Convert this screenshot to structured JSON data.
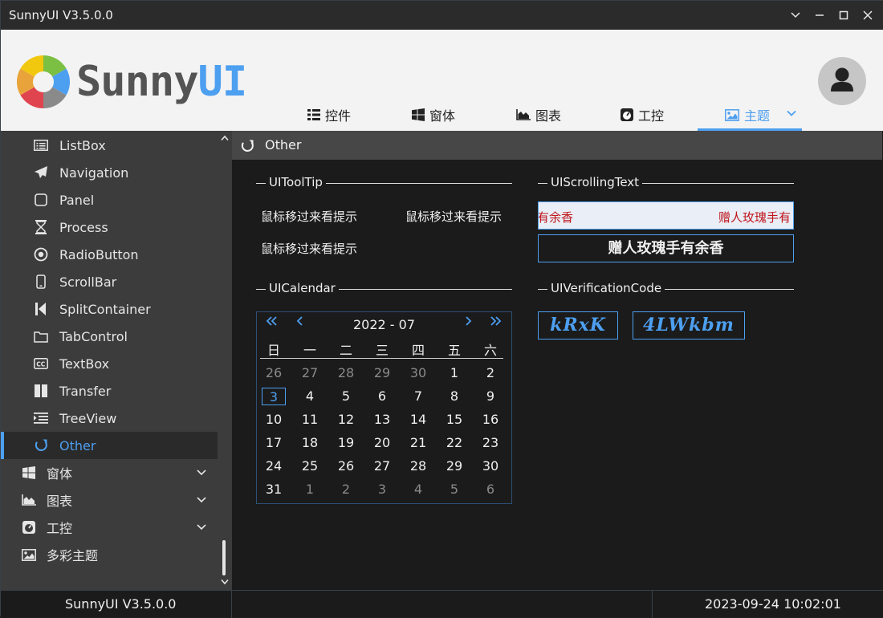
{
  "window": {
    "title": "SunnyUI V3.5.0.0"
  },
  "header": {
    "logo": {
      "part1": "Sunny",
      "part2": "UI"
    },
    "nav": [
      {
        "label": "控件",
        "icon": "list-icon"
      },
      {
        "label": "窗体",
        "icon": "windows-icon"
      },
      {
        "label": "图表",
        "icon": "area-chart-icon"
      },
      {
        "label": "工控",
        "icon": "gauge-icon"
      },
      {
        "label": "主题",
        "icon": "image-icon",
        "active": true
      }
    ]
  },
  "sidebar": {
    "items": [
      {
        "label": "ListBox",
        "icon": "list-alt-icon"
      },
      {
        "label": "Navigation",
        "icon": "paper-plane-icon"
      },
      {
        "label": "Panel",
        "icon": "square-icon"
      },
      {
        "label": "Process",
        "icon": "hourglass-icon"
      },
      {
        "label": "RadioButton",
        "icon": "dot-circle-icon"
      },
      {
        "label": "ScrollBar",
        "icon": "mobile-icon"
      },
      {
        "label": "SplitContainer",
        "icon": "step-backward-icon"
      },
      {
        "label": "TabControl",
        "icon": "folder-icon"
      },
      {
        "label": "TextBox",
        "icon": "cc-icon"
      },
      {
        "label": "Transfer",
        "icon": "columns-icon"
      },
      {
        "label": "TreeView",
        "icon": "indent-icon"
      },
      {
        "label": "Other",
        "icon": "rotate-icon",
        "selected": true
      }
    ],
    "groups": [
      {
        "label": "窗体",
        "icon": "windows-icon"
      },
      {
        "label": "图表",
        "icon": "area-chart-icon"
      },
      {
        "label": "工控",
        "icon": "gauge-icon"
      },
      {
        "label": "多彩主题",
        "icon": "image-icon"
      }
    ]
  },
  "main": {
    "title": "Other",
    "tooltip_group": {
      "title": "UIToolTip",
      "labels": [
        "鼠标移过来看提示",
        "鼠标移过来看提示",
        "鼠标移过来看提示"
      ]
    },
    "scrolling_group": {
      "title": "UIScrollingText",
      "text_left": "有余香",
      "text_right": "赠人玫瑰手有",
      "button_text": "赠人玫瑰手有余香"
    },
    "calendar_group": {
      "title": "UICalendar",
      "year_month": "2022 - 07",
      "weekdays": [
        "日",
        "一",
        "二",
        "三",
        "四",
        "五",
        "六"
      ],
      "days": [
        [
          "26",
          "27",
          "28",
          "29",
          "30",
          "1",
          "2"
        ],
        [
          "3",
          "4",
          "5",
          "6",
          "7",
          "8",
          "9"
        ],
        [
          "10",
          "11",
          "12",
          "13",
          "14",
          "15",
          "16"
        ],
        [
          "17",
          "18",
          "19",
          "20",
          "21",
          "22",
          "23"
        ],
        [
          "24",
          "25",
          "26",
          "27",
          "28",
          "29",
          "30"
        ],
        [
          "31",
          "1",
          "2",
          "3",
          "4",
          "5",
          "6"
        ]
      ],
      "today": "3"
    },
    "verification_group": {
      "title": "UIVerificationCode",
      "codes": [
        "kRxK",
        "4LWkbm"
      ]
    }
  },
  "statusbar": {
    "version": "SunnyUI V3.5.0.0",
    "middle": "",
    "datetime": "2023-09-24 10:02:01"
  },
  "colors": {
    "accent": "#4d9ff0",
    "scroll_text": "#c0161c"
  }
}
